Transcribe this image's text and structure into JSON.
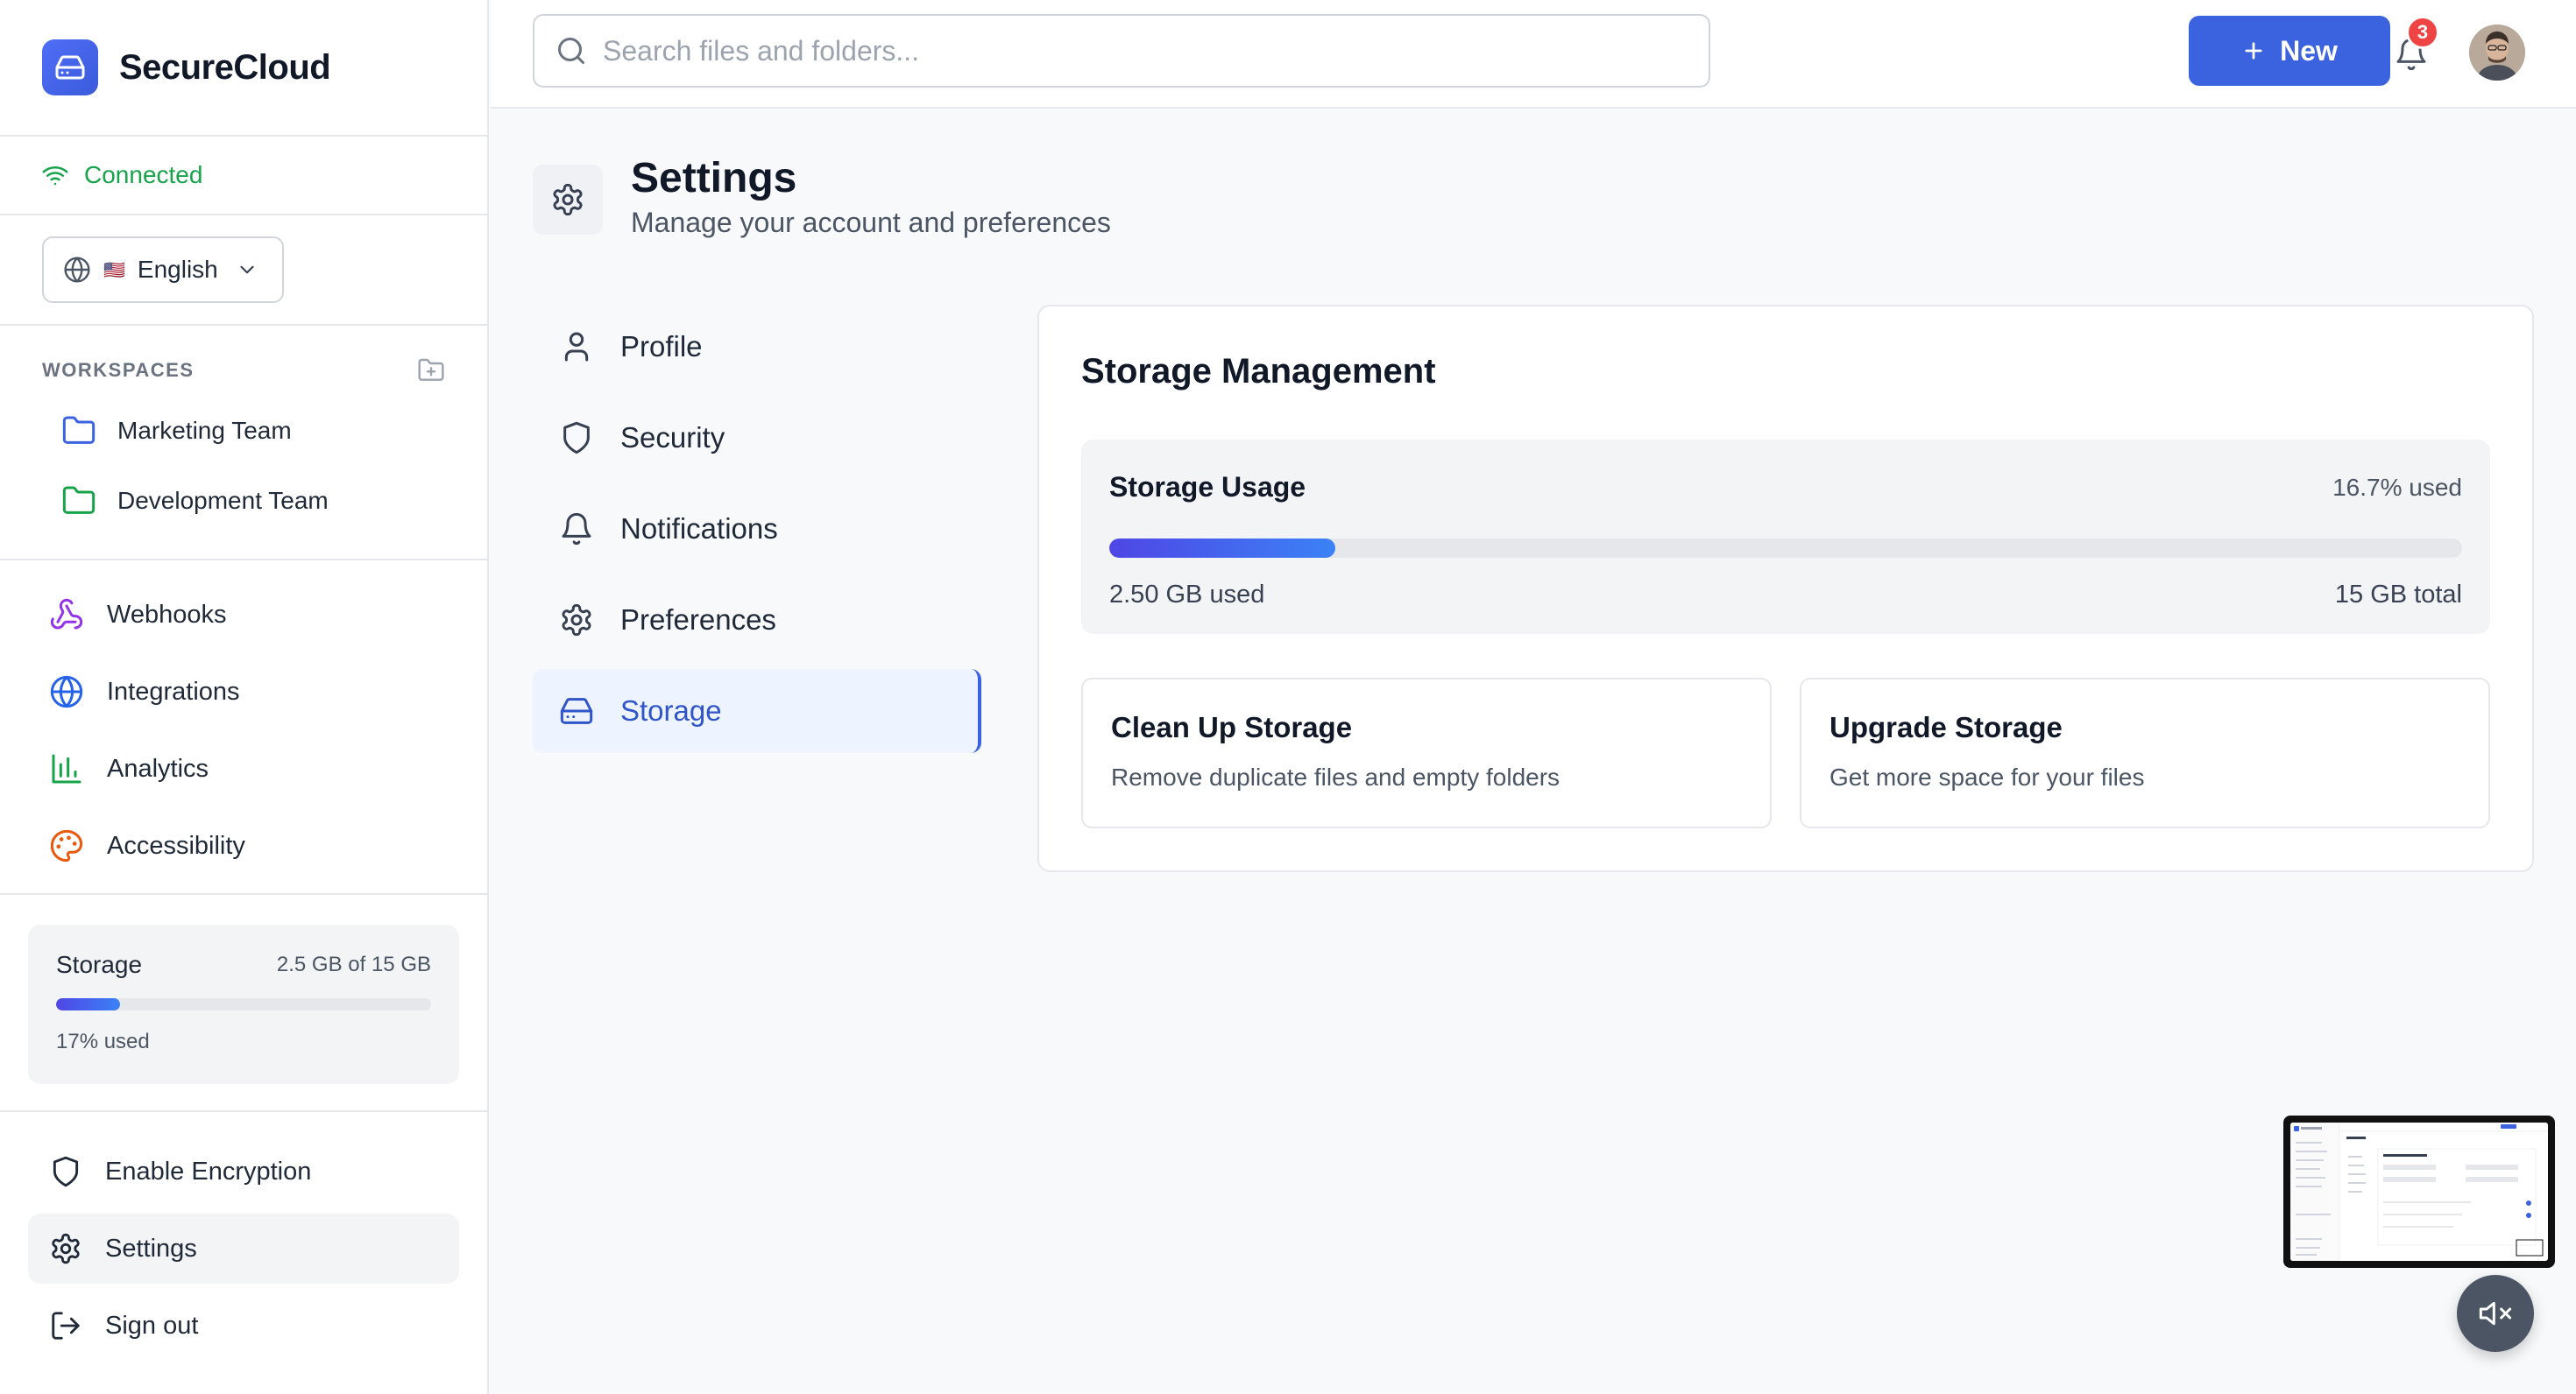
{
  "app": {
    "name": "SecureCloud"
  },
  "sidebar": {
    "connection_status": "Connected",
    "language": {
      "flag": "🇺🇸",
      "label": "English"
    },
    "workspaces": {
      "title": "WORKSPACES",
      "items": [
        {
          "label": "Marketing Team",
          "color": "#3b63e0"
        },
        {
          "label": "Development Team",
          "color": "#16a34a"
        }
      ]
    },
    "nav": [
      {
        "label": "Webhooks",
        "icon": "webhook-icon",
        "color": "#9333ea"
      },
      {
        "label": "Integrations",
        "icon": "globe-icon",
        "color": "#2563eb"
      },
      {
        "label": "Analytics",
        "icon": "bar-chart-icon",
        "color": "#16a34a"
      },
      {
        "label": "Accessibility",
        "icon": "palette-icon",
        "color": "#ea580c"
      }
    ],
    "storage": {
      "label": "Storage",
      "amount": "2.5 GB of 15 GB",
      "percent_text": "17% used",
      "fill_fraction": 0.17
    },
    "bottom": [
      {
        "label": "Enable Encryption",
        "icon": "shield-icon"
      },
      {
        "label": "Settings",
        "icon": "gear-icon"
      },
      {
        "label": "Sign out",
        "icon": "sign-out-icon"
      }
    ]
  },
  "topbar": {
    "search_placeholder": "Search files and folders...",
    "new_label": "New",
    "notification_count": "3"
  },
  "page": {
    "title": "Settings",
    "subtitle": "Manage your account and preferences"
  },
  "settings_nav": [
    {
      "label": "Profile",
      "icon": "user-icon"
    },
    {
      "label": "Security",
      "icon": "shield-icon"
    },
    {
      "label": "Notifications",
      "icon": "bell-icon"
    },
    {
      "label": "Preferences",
      "icon": "gear-icon"
    },
    {
      "label": "Storage",
      "icon": "hard-drive-icon",
      "active": true
    }
  ],
  "storage_panel": {
    "title": "Storage Management",
    "usage": {
      "title": "Storage Usage",
      "percent_text": "16.7% used",
      "fill_fraction": 0.167,
      "used": "2.50 GB used",
      "total": "15 GB total"
    },
    "actions": [
      {
        "title": "Clean Up Storage",
        "desc": "Remove duplicate files and empty folders"
      },
      {
        "title": "Upgrade Storage",
        "desc": "Get more space for your files"
      }
    ]
  },
  "colors": {
    "accent": "#3b63e0",
    "success": "#16a34a",
    "danger": "#ef4444"
  }
}
